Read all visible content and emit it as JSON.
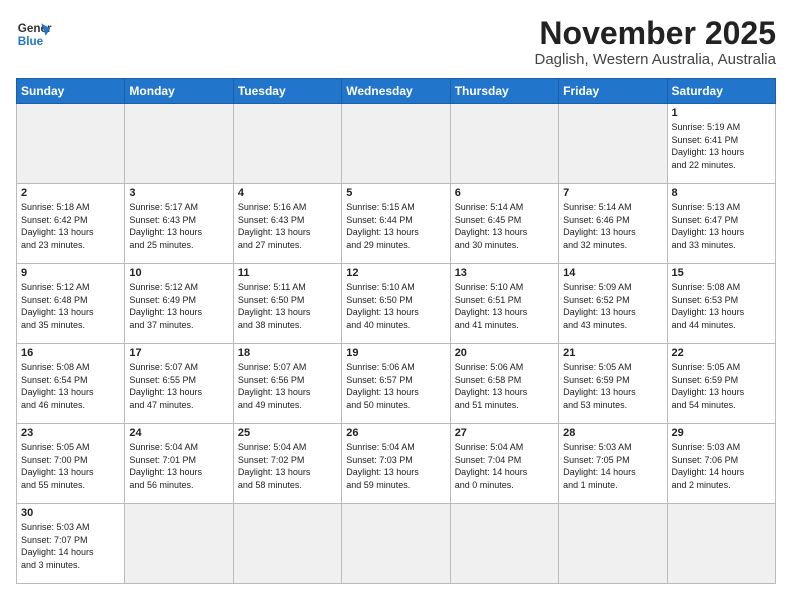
{
  "header": {
    "logo_line1": "General",
    "logo_line2": "Blue",
    "month": "November 2025",
    "location": "Daglish, Western Australia, Australia"
  },
  "days_of_week": [
    "Sunday",
    "Monday",
    "Tuesday",
    "Wednesday",
    "Thursday",
    "Friday",
    "Saturday"
  ],
  "weeks": [
    [
      {
        "day": "",
        "info": ""
      },
      {
        "day": "",
        "info": ""
      },
      {
        "day": "",
        "info": ""
      },
      {
        "day": "",
        "info": ""
      },
      {
        "day": "",
        "info": ""
      },
      {
        "day": "",
        "info": ""
      },
      {
        "day": "1",
        "info": "Sunrise: 5:19 AM\nSunset: 6:41 PM\nDaylight: 13 hours\nand 22 minutes."
      }
    ],
    [
      {
        "day": "2",
        "info": "Sunrise: 5:18 AM\nSunset: 6:42 PM\nDaylight: 13 hours\nand 23 minutes."
      },
      {
        "day": "3",
        "info": "Sunrise: 5:17 AM\nSunset: 6:43 PM\nDaylight: 13 hours\nand 25 minutes."
      },
      {
        "day": "4",
        "info": "Sunrise: 5:16 AM\nSunset: 6:43 PM\nDaylight: 13 hours\nand 27 minutes."
      },
      {
        "day": "5",
        "info": "Sunrise: 5:15 AM\nSunset: 6:44 PM\nDaylight: 13 hours\nand 29 minutes."
      },
      {
        "day": "6",
        "info": "Sunrise: 5:14 AM\nSunset: 6:45 PM\nDaylight: 13 hours\nand 30 minutes."
      },
      {
        "day": "7",
        "info": "Sunrise: 5:14 AM\nSunset: 6:46 PM\nDaylight: 13 hours\nand 32 minutes."
      },
      {
        "day": "8",
        "info": "Sunrise: 5:13 AM\nSunset: 6:47 PM\nDaylight: 13 hours\nand 33 minutes."
      }
    ],
    [
      {
        "day": "9",
        "info": "Sunrise: 5:12 AM\nSunset: 6:48 PM\nDaylight: 13 hours\nand 35 minutes."
      },
      {
        "day": "10",
        "info": "Sunrise: 5:12 AM\nSunset: 6:49 PM\nDaylight: 13 hours\nand 37 minutes."
      },
      {
        "day": "11",
        "info": "Sunrise: 5:11 AM\nSunset: 6:50 PM\nDaylight: 13 hours\nand 38 minutes."
      },
      {
        "day": "12",
        "info": "Sunrise: 5:10 AM\nSunset: 6:50 PM\nDaylight: 13 hours\nand 40 minutes."
      },
      {
        "day": "13",
        "info": "Sunrise: 5:10 AM\nSunset: 6:51 PM\nDaylight: 13 hours\nand 41 minutes."
      },
      {
        "day": "14",
        "info": "Sunrise: 5:09 AM\nSunset: 6:52 PM\nDaylight: 13 hours\nand 43 minutes."
      },
      {
        "day": "15",
        "info": "Sunrise: 5:08 AM\nSunset: 6:53 PM\nDaylight: 13 hours\nand 44 minutes."
      }
    ],
    [
      {
        "day": "16",
        "info": "Sunrise: 5:08 AM\nSunset: 6:54 PM\nDaylight: 13 hours\nand 46 minutes."
      },
      {
        "day": "17",
        "info": "Sunrise: 5:07 AM\nSunset: 6:55 PM\nDaylight: 13 hours\nand 47 minutes."
      },
      {
        "day": "18",
        "info": "Sunrise: 5:07 AM\nSunset: 6:56 PM\nDaylight: 13 hours\nand 49 minutes."
      },
      {
        "day": "19",
        "info": "Sunrise: 5:06 AM\nSunset: 6:57 PM\nDaylight: 13 hours\nand 50 minutes."
      },
      {
        "day": "20",
        "info": "Sunrise: 5:06 AM\nSunset: 6:58 PM\nDaylight: 13 hours\nand 51 minutes."
      },
      {
        "day": "21",
        "info": "Sunrise: 5:05 AM\nSunset: 6:59 PM\nDaylight: 13 hours\nand 53 minutes."
      },
      {
        "day": "22",
        "info": "Sunrise: 5:05 AM\nSunset: 6:59 PM\nDaylight: 13 hours\nand 54 minutes."
      }
    ],
    [
      {
        "day": "23",
        "info": "Sunrise: 5:05 AM\nSunset: 7:00 PM\nDaylight: 13 hours\nand 55 minutes."
      },
      {
        "day": "24",
        "info": "Sunrise: 5:04 AM\nSunset: 7:01 PM\nDaylight: 13 hours\nand 56 minutes."
      },
      {
        "day": "25",
        "info": "Sunrise: 5:04 AM\nSunset: 7:02 PM\nDaylight: 13 hours\nand 58 minutes."
      },
      {
        "day": "26",
        "info": "Sunrise: 5:04 AM\nSunset: 7:03 PM\nDaylight: 13 hours\nand 59 minutes."
      },
      {
        "day": "27",
        "info": "Sunrise: 5:04 AM\nSunset: 7:04 PM\nDaylight: 14 hours\nand 0 minutes."
      },
      {
        "day": "28",
        "info": "Sunrise: 5:03 AM\nSunset: 7:05 PM\nDaylight: 14 hours\nand 1 minute."
      },
      {
        "day": "29",
        "info": "Sunrise: 5:03 AM\nSunset: 7:06 PM\nDaylight: 14 hours\nand 2 minutes."
      }
    ],
    [
      {
        "day": "30",
        "info": "Sunrise: 5:03 AM\nSunset: 7:07 PM\nDaylight: 14 hours\nand 3 minutes."
      },
      {
        "day": "",
        "info": ""
      },
      {
        "day": "",
        "info": ""
      },
      {
        "day": "",
        "info": ""
      },
      {
        "day": "",
        "info": ""
      },
      {
        "day": "",
        "info": ""
      },
      {
        "day": "",
        "info": ""
      }
    ]
  ]
}
